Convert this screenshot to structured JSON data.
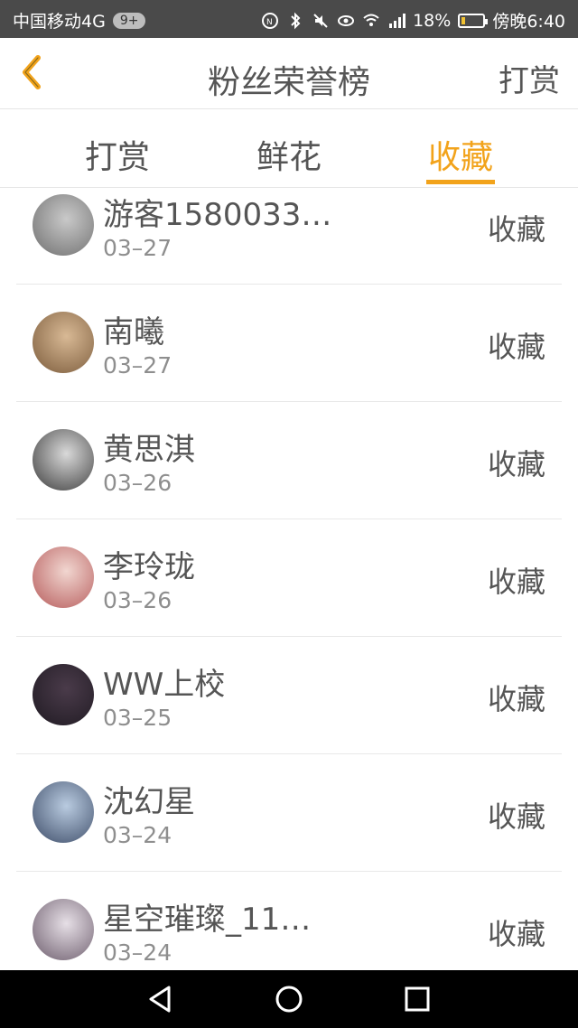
{
  "status_bar": {
    "carrier": "中国移动4G",
    "badge": "9+",
    "battery": "18%",
    "time": "傍晚6:40",
    "battery_level": 0.18
  },
  "header": {
    "title": "粉丝荣誉榜",
    "action_label": "打赏"
  },
  "tabs": [
    {
      "label": "打赏"
    },
    {
      "label": "鲜花"
    },
    {
      "label": "收藏"
    }
  ],
  "active_tab": "收藏",
  "fans": [
    {
      "name": "游客1580033…",
      "date": "03–27",
      "type": "收藏",
      "avatar_colors": [
        "#c9c9c9",
        "#6e6e6e"
      ]
    },
    {
      "name": "南曦",
      "date": "03–27",
      "type": "收藏",
      "avatar_colors": [
        "#d8b995",
        "#7a5a3a"
      ]
    },
    {
      "name": "黄思淇",
      "date": "03–26",
      "type": "收藏",
      "avatar_colors": [
        "#d9d9d9",
        "#3a3a3a"
      ]
    },
    {
      "name": "李玲珑",
      "date": "03–26",
      "type": "收藏",
      "avatar_colors": [
        "#f1d6d0",
        "#b65a5a"
      ]
    },
    {
      "name": "WW上校",
      "date": "03–25",
      "type": "收藏",
      "avatar_colors": [
        "#4a3b4a",
        "#1f1a22"
      ]
    },
    {
      "name": "沈幻星",
      "date": "03–24",
      "type": "收藏",
      "avatar_colors": [
        "#b9cbe0",
        "#3b4a66"
      ]
    },
    {
      "name": "星空璀璨_11…",
      "date": "03–24",
      "type": "收藏",
      "avatar_colors": [
        "#e6dfe6",
        "#6b5b6b"
      ]
    }
  ],
  "colors": {
    "accent": "#f2a31b",
    "status_bar_bg": "#4a4a4a",
    "nav_bar_bg": "#000000",
    "divider": "#e8e8e8"
  },
  "icons": {
    "back": "chevron-left-icon",
    "nav_back": "triangle-back-icon",
    "nav_home": "circle-home-icon",
    "nav_recent": "square-recent-icon"
  }
}
